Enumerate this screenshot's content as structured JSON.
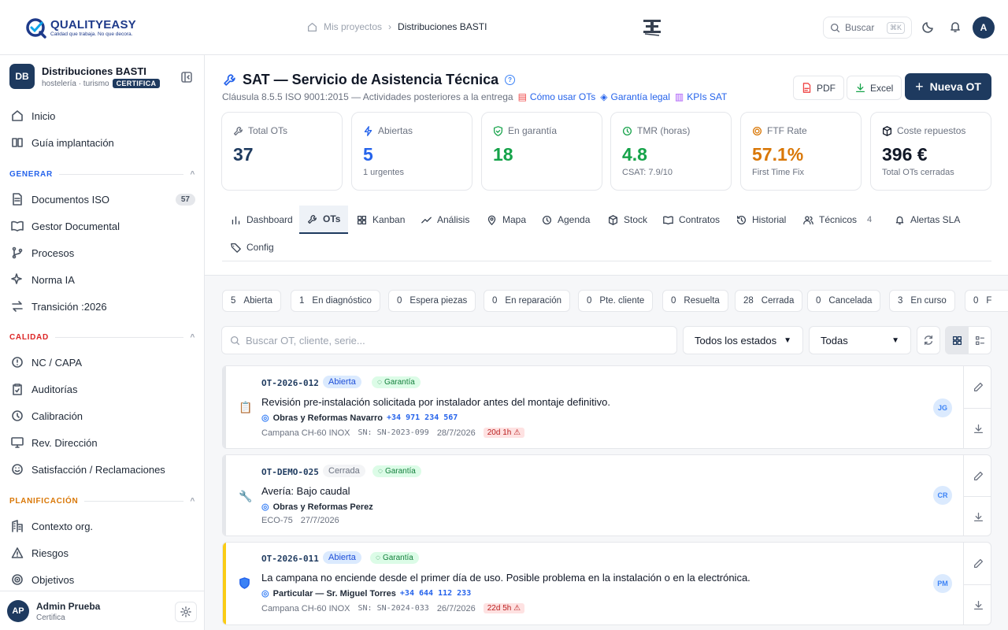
{
  "brand": {
    "name": "QUALITYEASY",
    "tagline": "Calidad que trabaja. No que decora."
  },
  "breadcrumb": {
    "root": "Mis proyectos",
    "current": "Distribuciones BASTI"
  },
  "topbar": {
    "search_label": "Buscar",
    "search_shortcut": "⌘K",
    "user_initial": "A"
  },
  "org": {
    "initials": "DB",
    "name": "Distribuciones BASTI",
    "sector": "hostelería · turismo",
    "badge": "CERTIFICA"
  },
  "sidebar": {
    "top": [
      {
        "label": "Inicio",
        "icon": "home-icon"
      },
      {
        "label": "Guía implantación",
        "icon": "book-icon"
      }
    ],
    "sections": [
      {
        "title": "GENERAR",
        "color": "#2563eb",
        "items": [
          {
            "label": "Documentos ISO",
            "count": "57"
          },
          {
            "label": "Gestor Documental"
          },
          {
            "label": "Procesos"
          },
          {
            "label": "Norma IA"
          },
          {
            "label": "Transición :2026"
          }
        ]
      },
      {
        "title": "CALIDAD",
        "color": "#dc2626",
        "items": [
          {
            "label": "NC / CAPA"
          },
          {
            "label": "Auditorías"
          },
          {
            "label": "Calibración"
          },
          {
            "label": "Rev. Dirección"
          },
          {
            "label": "Satisfacción / Reclamaciones"
          }
        ]
      },
      {
        "title": "PLANIFICACIÓN",
        "color": "#d97706",
        "items": [
          {
            "label": "Contexto org."
          },
          {
            "label": "Riesgos"
          },
          {
            "label": "Objetivos"
          }
        ]
      }
    ]
  },
  "user": {
    "initials": "AP",
    "name": "Admin Prueba",
    "role": "Certifica"
  },
  "page": {
    "title": "SAT — Servicio de Asistencia Técnica",
    "subtitle": "Cláusula 8.5.5 ISO 9001:2015 — Actividades posteriores a la entrega",
    "links": [
      "Cómo usar OTs",
      "Garantía legal",
      "KPIs SAT"
    ],
    "buttons": {
      "pdf": "PDF",
      "excel": "Excel",
      "new": "Nueva OT"
    }
  },
  "kpis": [
    {
      "label": "Total OTs",
      "value": "37",
      "foot": "",
      "color": "#1e3a5f"
    },
    {
      "label": "Abiertas",
      "value": "5",
      "foot": "1 urgentes",
      "color": "#2563eb"
    },
    {
      "label": "En garantía",
      "value": "18",
      "foot": "",
      "color": "#16a34a"
    },
    {
      "label": "TMR (horas)",
      "value": "4.8",
      "foot": "CSAT: 7.9/10",
      "color": "#16a34a"
    },
    {
      "label": "FTF Rate",
      "value": "57.1%",
      "foot": "First Time Fix",
      "color": "#d97706"
    },
    {
      "label": "Coste repuestos",
      "value": "396 €",
      "foot": "Total OTs cerradas",
      "color": "#111827"
    }
  ],
  "tabs": [
    {
      "label": "Dashboard"
    },
    {
      "label": "OTs"
    },
    {
      "label": "Kanban"
    },
    {
      "label": "Análisis"
    },
    {
      "label": "Mapa"
    },
    {
      "label": "Agenda"
    },
    {
      "label": "Stock"
    },
    {
      "label": "Contratos"
    },
    {
      "label": "Historial"
    },
    {
      "label": "Técnicos",
      "count": "4"
    },
    {
      "label": "Alertas SLA"
    },
    {
      "label": "Config"
    }
  ],
  "status_chips": [
    {
      "n": "5",
      "label": "Abierta"
    },
    {
      "n": "1",
      "label": "En diagnóstico"
    },
    {
      "n": "0",
      "label": "Espera piezas"
    },
    {
      "n": "0",
      "label": "En reparación"
    },
    {
      "n": "0",
      "label": "Pte. cliente"
    },
    {
      "n": "0",
      "label": "Resuelta"
    },
    {
      "n": "28",
      "label": "Cerrada"
    },
    {
      "n": "0",
      "label": "Cancelada"
    },
    {
      "n": "3",
      "label": "En curso"
    },
    {
      "n": "0",
      "label": "F"
    }
  ],
  "filters": {
    "search_placeholder": "Buscar OT, cliente, serie...",
    "status": "Todos los estados",
    "type": "Todas"
  },
  "orders": [
    {
      "code": "OT-2026-012",
      "status": "Abierta",
      "warranty": "Garantía",
      "desc": "Revisión pre-instalación solicitada por instalador antes del montaje definitivo.",
      "client": "Obras y Reformas Navarro",
      "phone": "+34 971 234 567",
      "product": "Campana CH-60 INOX",
      "serial": "SN: SN-2023-099",
      "date": "28/7/2026",
      "sla": "20d 1h ⚠",
      "tech": "JG",
      "accent": "#e5e7eb"
    },
    {
      "code": "OT-DEMO-025",
      "status": "Cerrada",
      "warranty": "Garantía",
      "desc": "Avería: Bajo caudal",
      "client": "Obras y Reformas Perez",
      "phone": "",
      "product": "ECO-75",
      "serial": "",
      "date": "27/7/2026",
      "sla": "",
      "tech": "CR",
      "accent": "#e5e7eb"
    },
    {
      "code": "OT-2026-011",
      "status": "Abierta",
      "warranty": "Garantía",
      "desc": "La campana no enciende desde el primer día de uso. Posible problema en la instalación o en la electrónica.",
      "client": "Particular — Sr. Miguel Torres",
      "phone": "+34 644 112 233",
      "product": "Campana CH-60 INOX",
      "serial": "SN: SN-2024-033",
      "date": "26/7/2026",
      "sla": "22d 5h ⚠",
      "tech": "PM",
      "accent": "#facc15"
    }
  ]
}
